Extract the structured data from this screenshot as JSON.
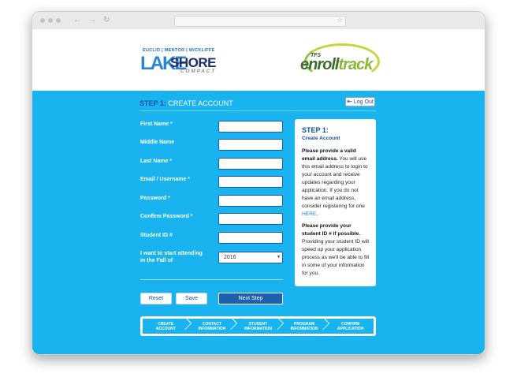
{
  "browser": {
    "nav_icons": [
      "back-arrow-icon",
      "forward-arrow-icon",
      "reload-icon"
    ],
    "nav_glyphs": [
      "←",
      "→",
      "↻"
    ],
    "star_glyph": "☆"
  },
  "logos": {
    "lakeshore": {
      "cities": "EUCLID | MENTOR | WICKLIFFE",
      "lake": "LAKE",
      "shore": "SHORE",
      "compact": "COMPACT"
    },
    "enrolltrack": {
      "tfs": "TFS",
      "enroll": "enroll",
      "track": "track"
    }
  },
  "step": {
    "number": "STEP 1:",
    "title": "CREATE ACCOUNT"
  },
  "logout": {
    "label": "Log Out",
    "icon": "logout-icon",
    "glyph": "⇤"
  },
  "form": {
    "fields": [
      {
        "label": "First Name *",
        "value": ""
      },
      {
        "label": "Middle Name",
        "value": ""
      },
      {
        "label": "Last Name *",
        "value": ""
      },
      {
        "label": "Email / Username *",
        "value": ""
      },
      {
        "label": "Password *",
        "value": ""
      },
      {
        "label": "Confirm Password *",
        "value": ""
      },
      {
        "label": "Student ID #",
        "value": ""
      }
    ],
    "start": {
      "label": "I want to start attending in the Fall of",
      "selected": "2016",
      "caret": "▾"
    }
  },
  "info": {
    "title": "STEP 1:",
    "subtitle": "Create Account",
    "p1_bold": "Please provide a valid email address.",
    "p1_text": " You will use this email address to login to your account and receive updates regarding your application. If you do not have an email address, consider registering for one ",
    "p1_link": "HERE",
    "p1_end": ".",
    "p2_bold": "Please provide your student ID # if possible.",
    "p2_text": " Providing your student ID will speed up your application process as we'll be able to fill in some of your information for you."
  },
  "buttons": {
    "reset": "Reset",
    "save": "Save",
    "next": "Next Step"
  },
  "progress": [
    {
      "line1": "CREATE",
      "line2": "ACCOUNT"
    },
    {
      "line1": "CONTACT",
      "line2": "INFORMATION"
    },
    {
      "line1": "STUDENT",
      "line2": "INFORMATION"
    },
    {
      "line1": "PROGRAM",
      "line2": "INFORMATION"
    },
    {
      "line1": "CONFIRM",
      "line2": "APPLICATION"
    }
  ],
  "colors": {
    "page_blue": "#19b3ef",
    "brand_dark": "#1552a3",
    "button_blue": "#1e5fae"
  }
}
